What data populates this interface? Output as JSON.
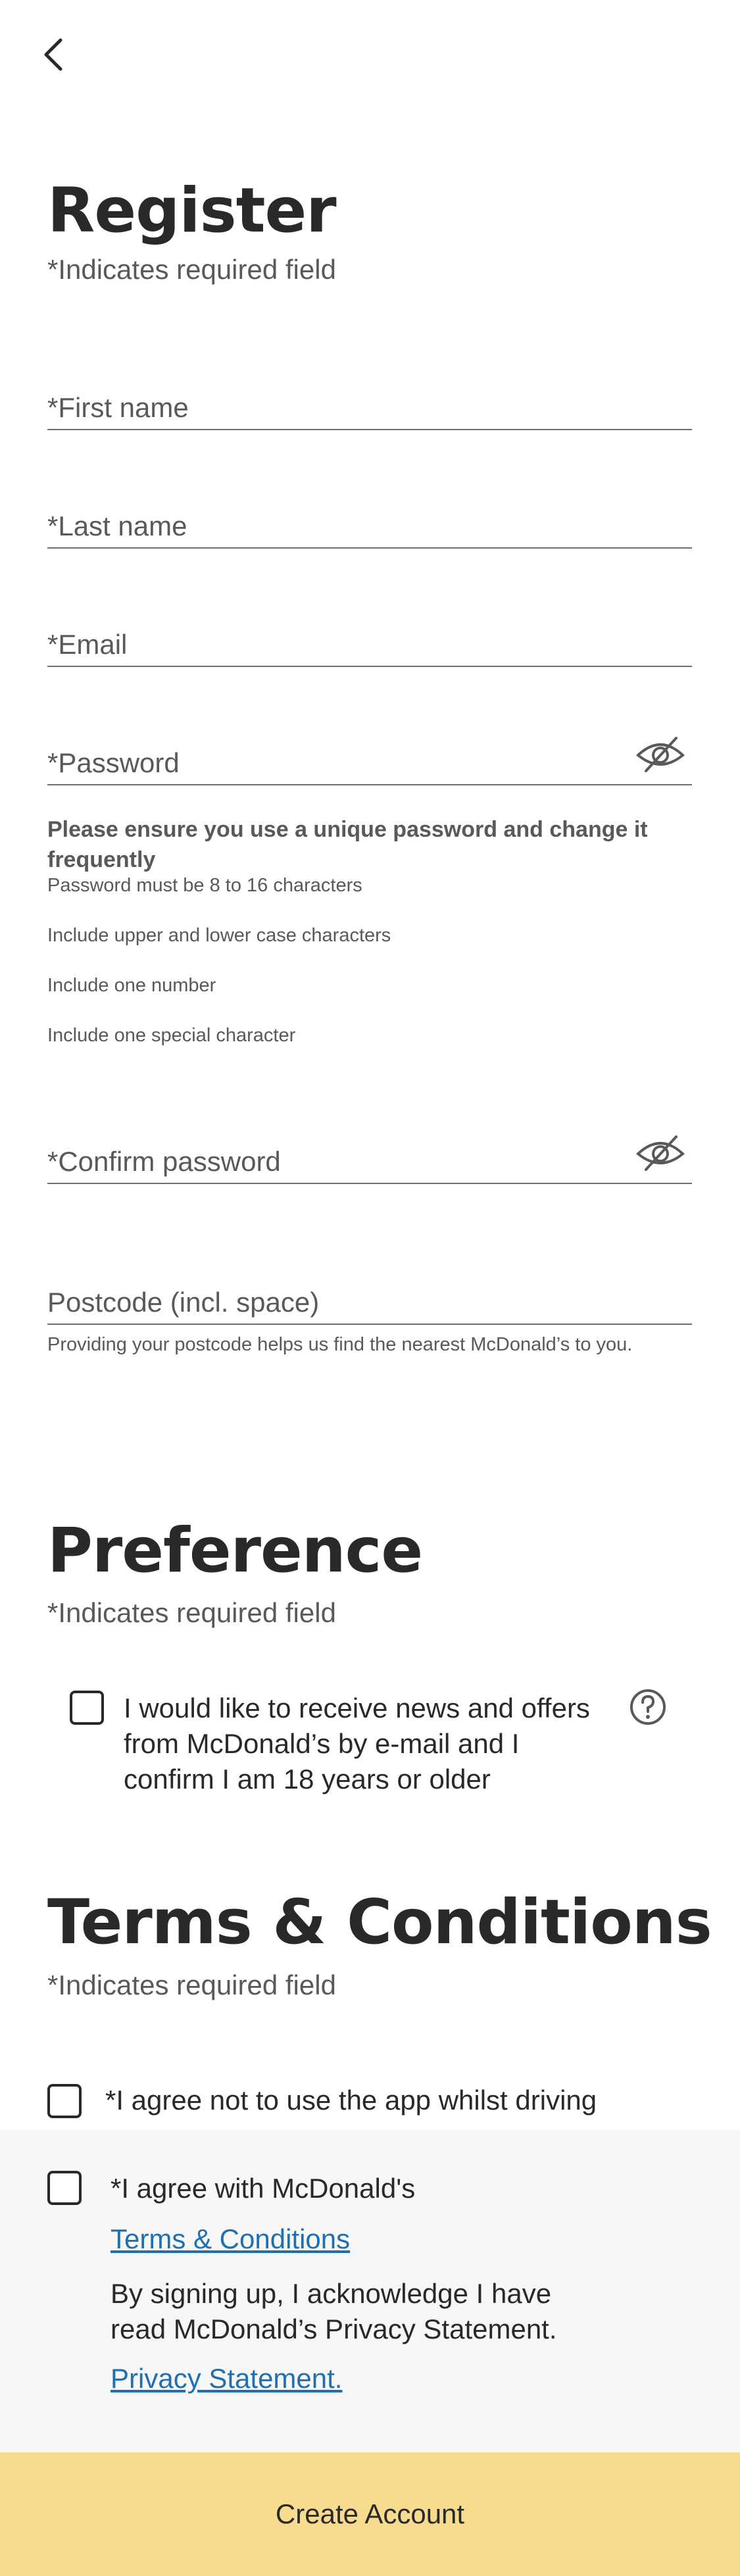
{
  "header": {
    "back_icon": "chevron-left-icon"
  },
  "register": {
    "title": "Register",
    "required_note": "*Indicates required field",
    "fields": {
      "first_name": {
        "placeholder": "*First name",
        "value": ""
      },
      "last_name": {
        "placeholder": "*Last name",
        "value": ""
      },
      "email": {
        "placeholder": "*Email",
        "value": ""
      },
      "password": {
        "placeholder": "*Password",
        "value": "",
        "toggle_icon": "eye-slash-icon"
      },
      "confirm_password": {
        "placeholder": "*Confirm password",
        "value": "",
        "toggle_icon": "eye-slash-icon"
      },
      "postcode": {
        "placeholder": "Postcode (incl. space)",
        "value": ""
      }
    },
    "password_guidance": {
      "heading": "Please ensure you use a unique password and change it frequently",
      "rules": [
        "Password must be 8 to 16 characters",
        "Include upper and lower case characters",
        "Include one number",
        "Include one special character"
      ]
    },
    "postcode_hint": "Providing your postcode helps us find the nearest McDonald’s to you."
  },
  "preference": {
    "title": "Preference",
    "required_note": "*Indicates required field",
    "news_offers_label": "I would like to receive news and offers from McDonald’s by e-mail and I confirm I am 18 years or older",
    "news_offers_checked": false,
    "help_icon": "question-circle-icon"
  },
  "terms": {
    "title": "Terms & Conditions",
    "required_note": "*Indicates required field",
    "driving_label": "*I agree not to use the app whilst driving",
    "driving_checked": false,
    "agree_label": "*I agree with McDonald's",
    "agree_checked": false,
    "terms_link": "Terms & Conditions",
    "privacy_text": "By signing up, I acknowledge I have read McDonald’s Privacy Statement.",
    "privacy_link": "Privacy Statement."
  },
  "footer": {
    "create_account_label": "Create Account"
  },
  "colors": {
    "text": "#292929",
    "secondary_text": "#595959",
    "link": "#1f6fb1",
    "panel_bg": "#f7f7f7",
    "button_bg": "#f7dc8f"
  }
}
